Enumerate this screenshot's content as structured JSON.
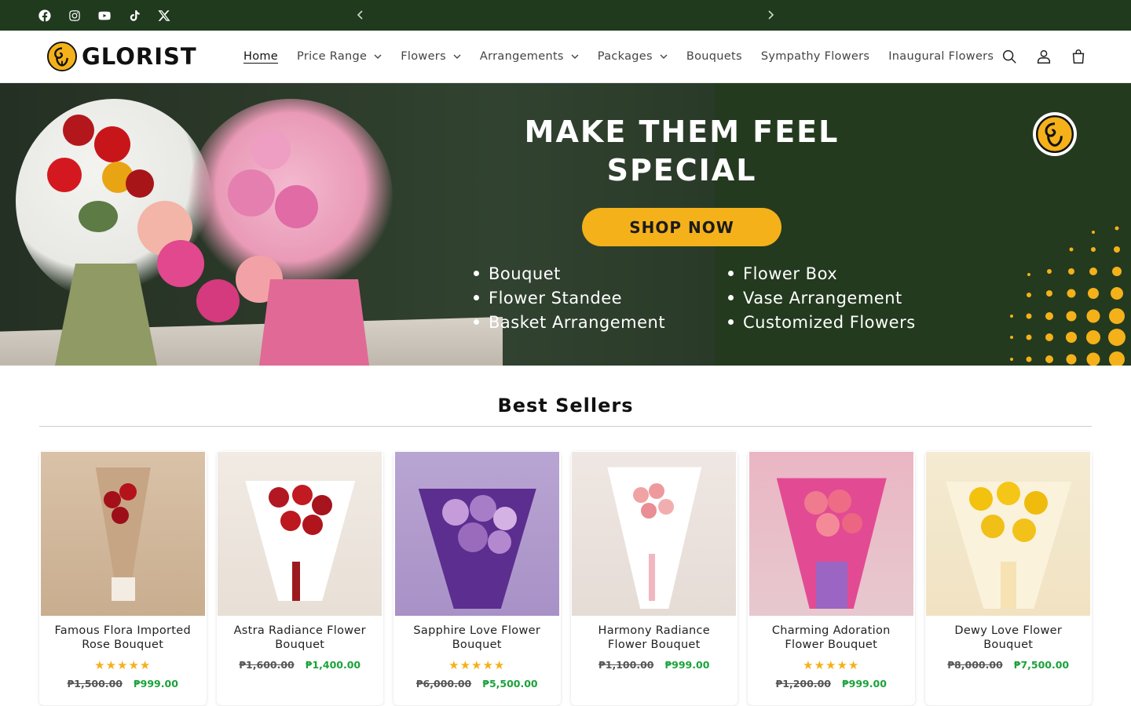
{
  "topbar": {
    "social_icons": [
      "facebook-icon",
      "instagram-icon",
      "youtube-icon",
      "tiktok-icon",
      "x-icon"
    ],
    "prev_icon": "chevron-left-icon",
    "next_icon": "chevron-right-icon",
    "background": "#1f3a1d"
  },
  "header": {
    "logo_text": "GLORIST",
    "nav": [
      {
        "label": "Home",
        "active": true,
        "dropdown": false
      },
      {
        "label": "Price Range",
        "active": false,
        "dropdown": true
      },
      {
        "label": "Flowers",
        "active": false,
        "dropdown": true
      },
      {
        "label": "Arrangements",
        "active": false,
        "dropdown": true
      },
      {
        "label": "Packages",
        "active": false,
        "dropdown": true
      },
      {
        "label": "Bouquets",
        "active": false,
        "dropdown": false
      },
      {
        "label": "Sympathy Flowers",
        "active": false,
        "dropdown": false
      },
      {
        "label": "Inaugural Flowers",
        "active": false,
        "dropdown": false
      }
    ],
    "icons": [
      "search-icon",
      "account-icon",
      "cart-icon"
    ]
  },
  "banner": {
    "headline_line1": "MAKE THEM FEEL",
    "headline_line2": "SPECIAL",
    "cta": "SHOP NOW",
    "bullets_left": [
      "Bouquet",
      "Flower Standee",
      "Basket Arrangement"
    ],
    "bullets_right": [
      "Flower Box",
      "Vase Arrangement",
      "Customized Flowers"
    ],
    "accent_color": "#f4b11a"
  },
  "best_sellers": {
    "title": "Best Sellers",
    "products": [
      {
        "name": "Famous Flora Imported Rose Bouquet",
        "stars": "★★★★★",
        "old_price": "₱1,500.00",
        "price": "₱999.00"
      },
      {
        "name": "Astra Radiance Flower Bouquet",
        "stars": "",
        "old_price": "₱1,600.00",
        "price": "₱1,400.00"
      },
      {
        "name": "Sapphire Love Flower Bouquet",
        "stars": "★★★★★",
        "old_price": "₱6,000.00",
        "price": "₱5,500.00"
      },
      {
        "name": "Harmony Radiance Flower Bouquet",
        "stars": "",
        "old_price": "₱1,100.00",
        "price": "₱999.00"
      },
      {
        "name": "Charming Adoration Flower Bouquet",
        "stars": "★★★★★",
        "old_price": "₱1,200.00",
        "price": "₱999.00"
      },
      {
        "name": "Dewy Love Flower Bouquet",
        "stars": "",
        "old_price": "₱8,000.00",
        "price": "₱7,500.00"
      }
    ],
    "sale_color": "#1aa33a"
  }
}
